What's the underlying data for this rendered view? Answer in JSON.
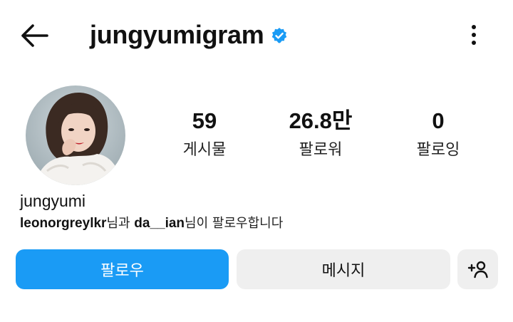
{
  "header": {
    "username": "jungyumigram",
    "verified": true,
    "icons": {
      "back": "back-arrow-icon",
      "verified": "verified-badge-icon",
      "more": "more-vertical-icon"
    }
  },
  "profile": {
    "avatar": "profile-photo",
    "display_name": "jungyumi",
    "stats": [
      {
        "value": "59",
        "label": "게시물"
      },
      {
        "value": "26.8만",
        "label": "팔로워"
      },
      {
        "value": "0",
        "label": "팔로잉"
      }
    ],
    "followed_by": {
      "user1": "leonorgreylkr",
      "connector": "님과 ",
      "user2": "da__ian",
      "suffix": "님이 팔로우합니다"
    }
  },
  "actions": {
    "follow_label": "팔로우",
    "message_label": "메시지",
    "add_user_icon": "add-user-icon"
  },
  "colors": {
    "accent": "#1a9bf5",
    "verified": "#1a9bf5",
    "secondary_button": "#efefef"
  }
}
